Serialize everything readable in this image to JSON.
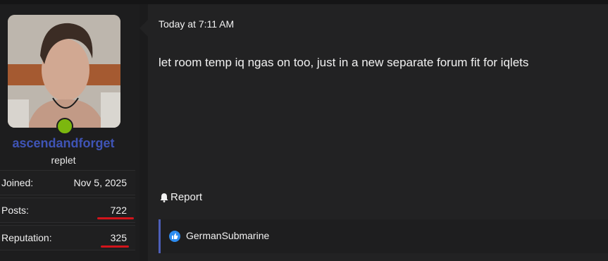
{
  "user": {
    "username": "ascendandforget",
    "title": "replet",
    "stats": [
      {
        "label": "Joined:",
        "value": "Nov 5, 2025"
      },
      {
        "label": "Posts:",
        "value": "722"
      },
      {
        "label": "Reputation:",
        "value": "325"
      }
    ]
  },
  "message": {
    "timestamp": "Today at 7:11 AM",
    "body": "let room temp iq ngas on too, just in a new separate forum fit for iqlets",
    "report_label": "Report"
  },
  "reactions": {
    "users": [
      "GermanSubmarine"
    ]
  },
  "colors": {
    "username": "#3f54b6",
    "online": "#7cb70f",
    "annotation": "#d2141b",
    "reaction_bar": "#4d5fb8",
    "like": "#2d8cf0"
  }
}
